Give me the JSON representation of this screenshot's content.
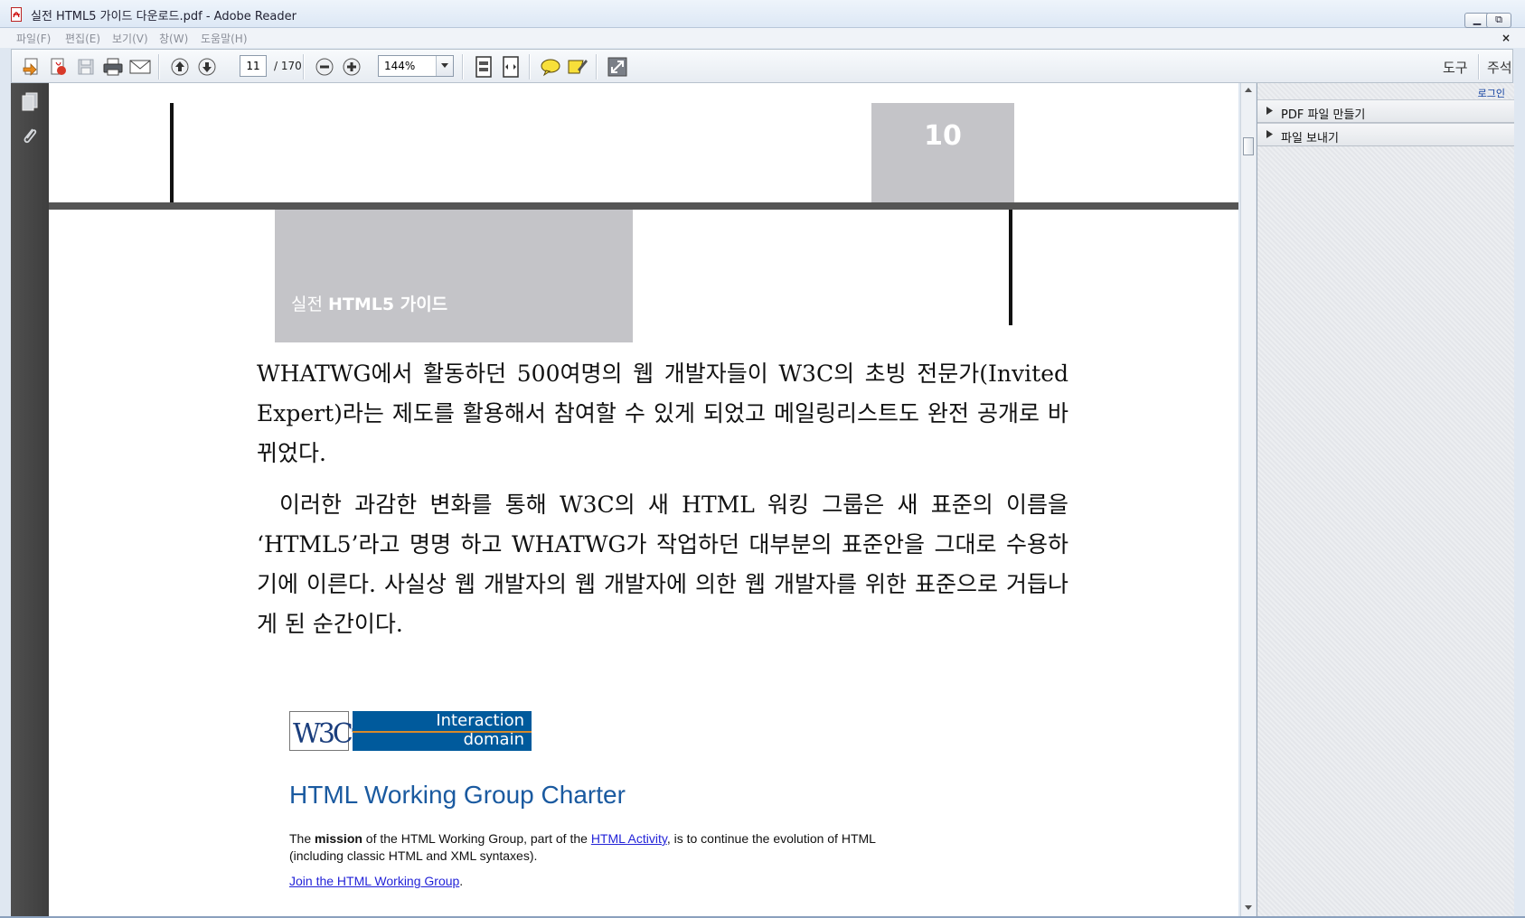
{
  "window": {
    "title": "실전 HTML5 가이드 다운로드.pdf - Adobe Reader",
    "minimize": "▭",
    "restore": "⧉",
    "close": "✕",
    "doc_close": "×"
  },
  "menu": [
    "파일(F)",
    "편집(E)",
    "보기(V)",
    "창(W)",
    "도움말(H)"
  ],
  "toolbar": {
    "page_current": "11",
    "page_total": "/ 170",
    "zoom": "144%",
    "tools_label": "도구",
    "comment_label": "주석"
  },
  "right_panel": {
    "login": "로그인",
    "items": [
      {
        "label": "PDF 파일 만들기"
      },
      {
        "label": "파일 보내기"
      }
    ]
  },
  "document": {
    "page_number": "10",
    "book_title_prefix": "실전 ",
    "book_title_main": "HTML5 가이드",
    "paragraph1": "WHATWG에서 활동하던 500여명의 웹 개발자들이 W3C의 초빙 전문가(Invited Expert)라는 제도를 활용해서 참여할 수 있게 되었고 메일링리스트도 완전 공개로 바뀌었다.",
    "paragraph2": "이러한 과감한 변화를 통해 W3C의 새 HTML 워킹 그룹은 새 표준의 이름을 ‘HTML5’라고 명명 하고 WHATWG가 작업하던 대부분의 표준안을 그대로 수용하기에 이른다. 사실상 웹 개발자의 웹 개발자에 의한 웹 개발자를 위한 표준으로 거듭나게 된 순간이다.",
    "w3c_logo_text": "W3C",
    "w3c_reg": "®",
    "interaction_line1": "Interaction",
    "interaction_line2": "domain",
    "charter_title": "HTML Working Group Charter",
    "charter_p_the": "The ",
    "charter_p_mission": "mission",
    "charter_p_mid": " of the HTML Working Group, part of the ",
    "charter_p_link": "HTML Activity",
    "charter_p_end": ", is to continue the evolution of HTML (including classic HTML and XML syntaxes).",
    "join_link": "Join the HTML Working Group",
    "join_period": "."
  },
  "colors": {
    "accent_blue": "#005a9c",
    "charter_blue": "#1a5aa0",
    "link_blue": "#2323d8",
    "header_gray": "#c4c4c8"
  }
}
